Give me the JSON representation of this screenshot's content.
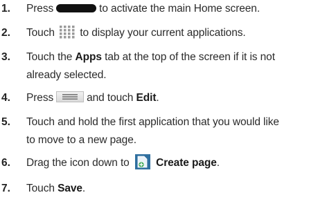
{
  "steps": [
    {
      "num": "1.",
      "before": "Press",
      "after": "to activate the main Home screen.",
      "icon": "home-key-icon"
    },
    {
      "num": "2.",
      "before": "Touch",
      "after": "to display your current applications.",
      "icon": "apps-grid-icon"
    },
    {
      "num": "3.",
      "line1_a": "Touch the",
      "line1_bold": "Apps",
      "line1_b": "tab at the top of the screen if it is not",
      "line2": "already selected."
    },
    {
      "num": "4.",
      "before": "Press",
      "middle": "and touch",
      "bold": "Edit",
      "end": ".",
      "icon": "menu-key-icon"
    },
    {
      "num": "5.",
      "line1": "Touch and hold the first application that you would like",
      "line2": "to move to a new page."
    },
    {
      "num": "6.",
      "before": "Drag the icon down to",
      "bold": "Create page",
      "end": ".",
      "icon": "create-page-icon"
    },
    {
      "num": "7.",
      "before": "Touch",
      "bold": "Save",
      "end": "."
    }
  ],
  "colors": {
    "text": "#2b2b2b",
    "home_key": "#111111",
    "create_page_icon": "#2f6f9f"
  }
}
